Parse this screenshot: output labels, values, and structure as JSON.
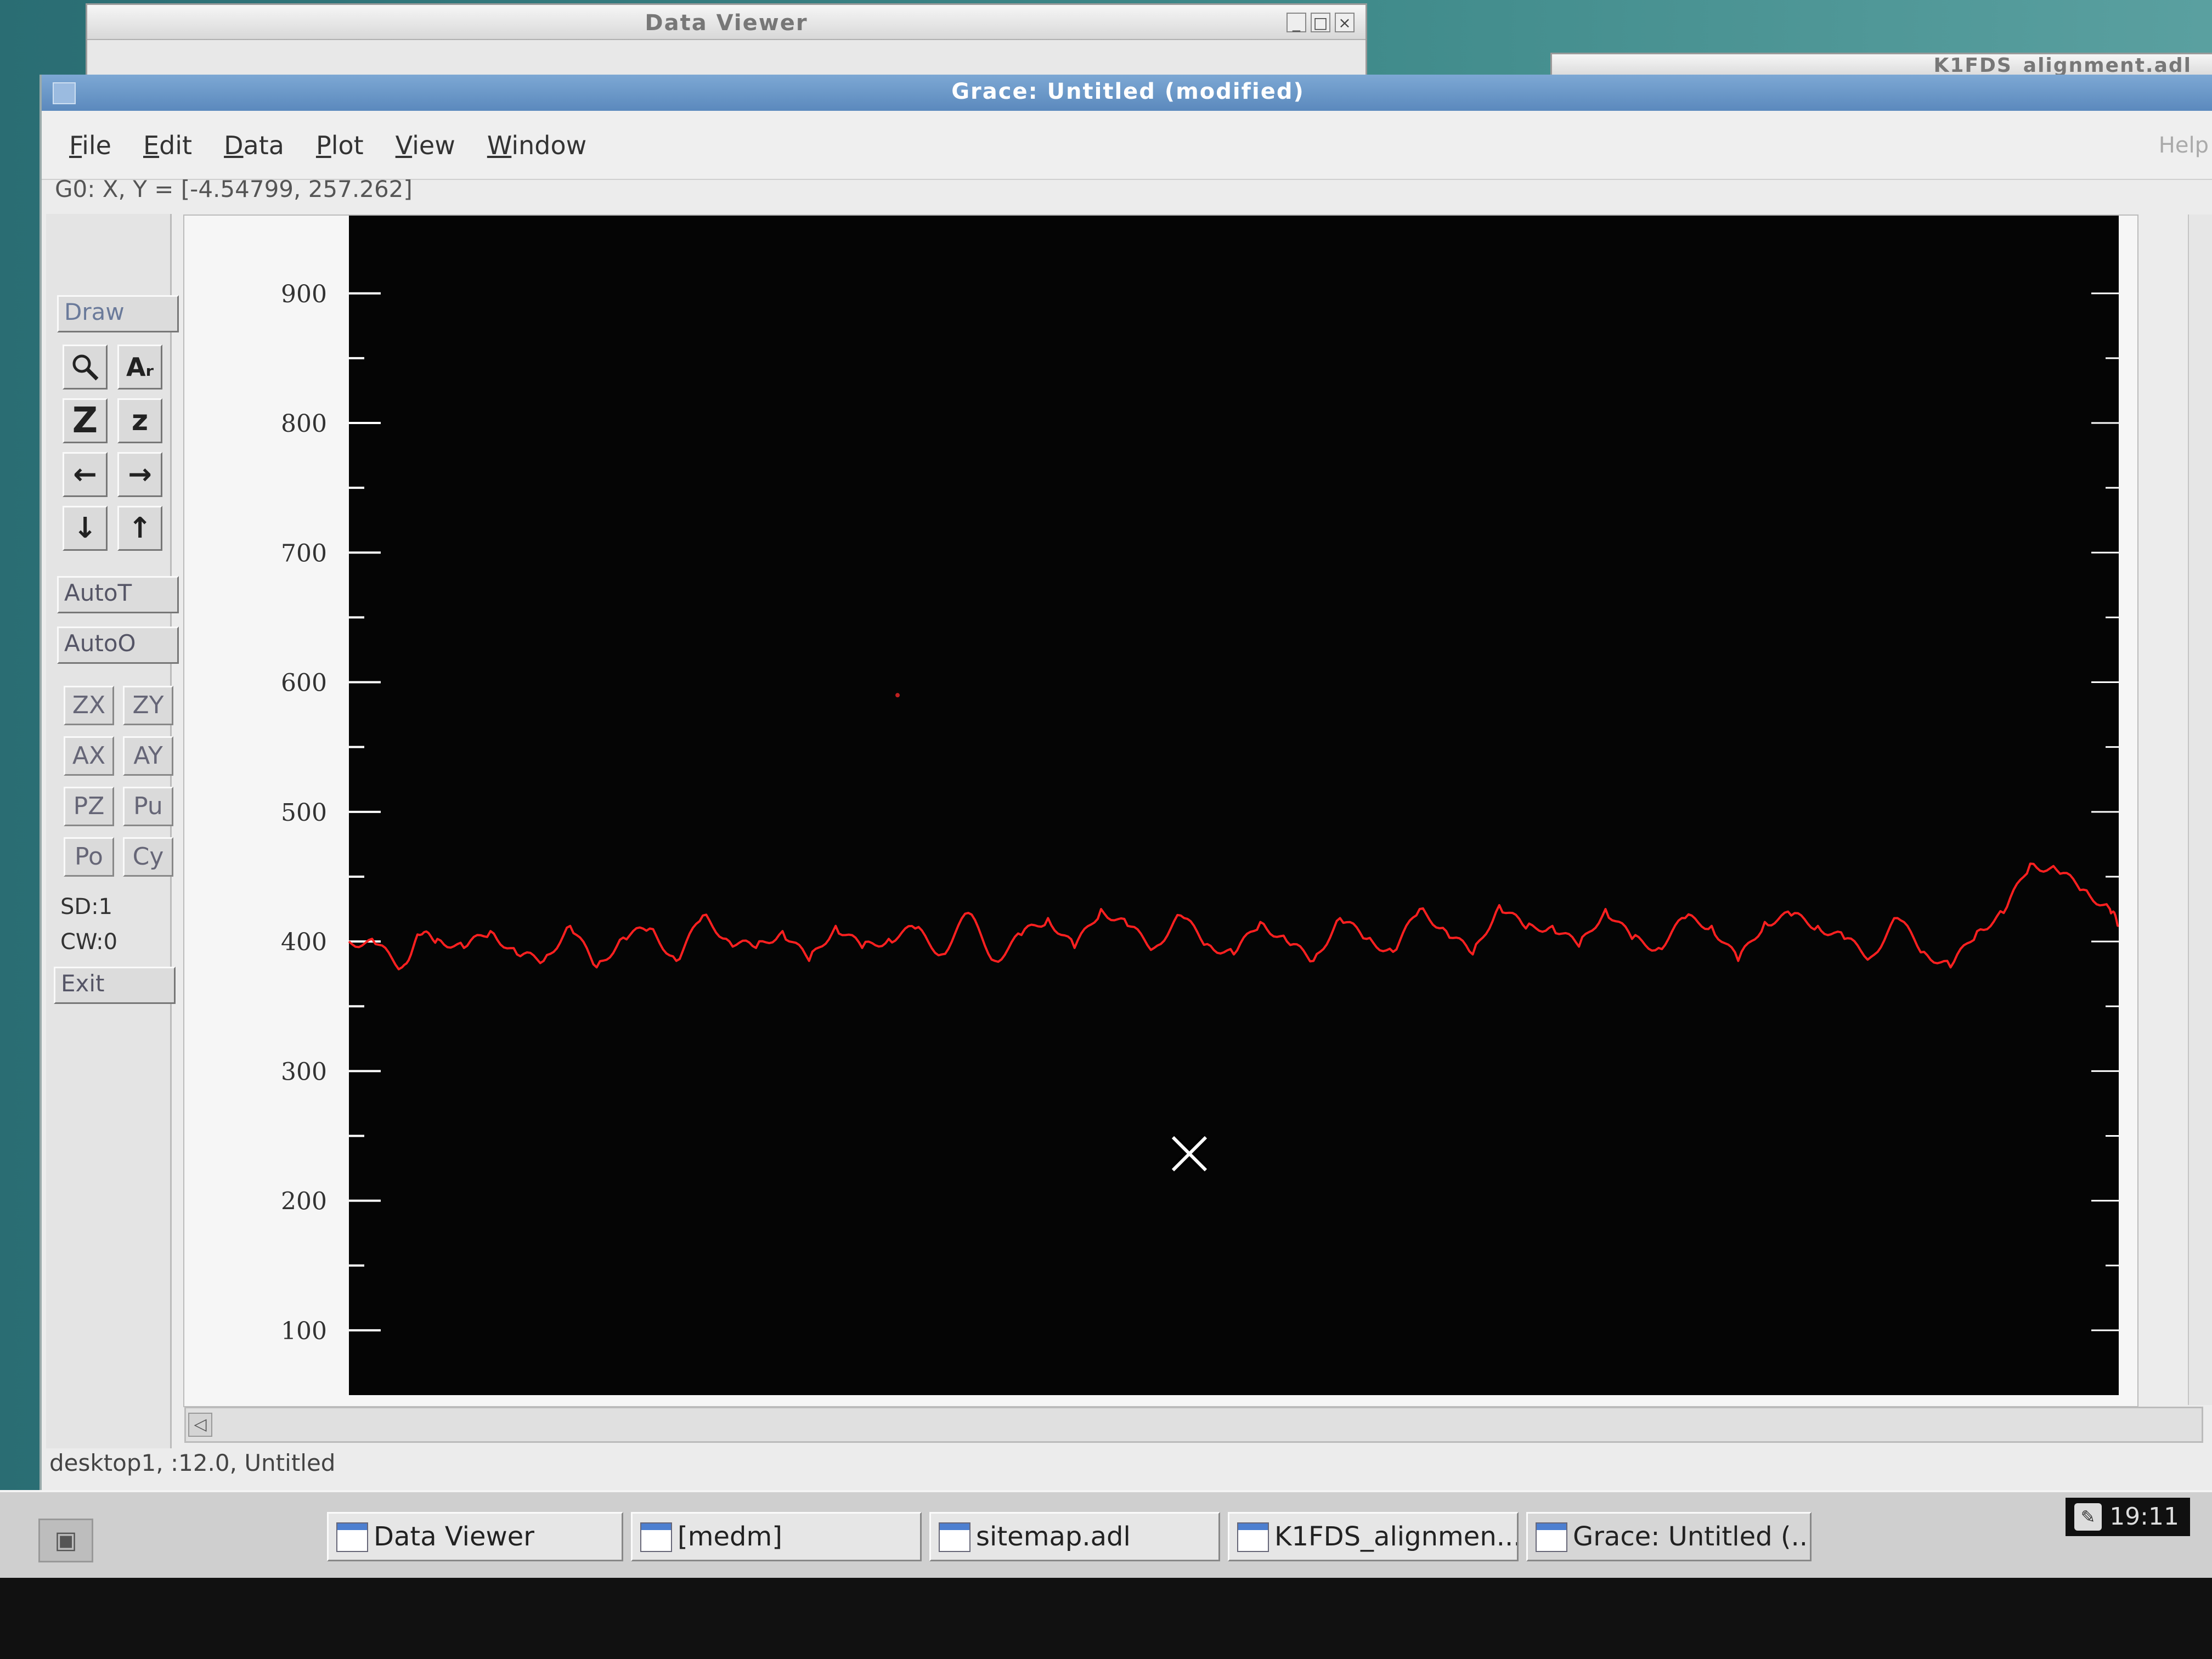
{
  "windows": {
    "data_viewer_title": "Data Viewer",
    "right_window_title": "K1FDS_alignment.adl",
    "main_title": "Grace: Untitled (modified)",
    "window_controls": [
      "_",
      "□",
      "×"
    ]
  },
  "menu": {
    "file": "File",
    "edit": "Edit",
    "data": "Data",
    "plot": "Plot",
    "view": "View",
    "window": "Window",
    "help": "Help"
  },
  "coords_readout": "G0: X, Y = [-4.54799, 257.262]",
  "toolbar": {
    "draw": "Draw",
    "zoom_icon": "🔍",
    "as_label": "Aᵣ",
    "z_large": "Z",
    "z_small": "z",
    "left_arrow": "←",
    "right_arrow": "→",
    "down_arrow": "↓",
    "up_arrow": "↑",
    "autot": "AutoT",
    "autoo": "AutoO",
    "zx": "ZX",
    "zy": "ZY",
    "ax": "AX",
    "ay": "AY",
    "pz": "PZ",
    "pu": "Pu",
    "po": "Po",
    "cy": "Cy",
    "sd": "SD:1",
    "cw": "CW:0",
    "exit": "Exit"
  },
  "chart_data": {
    "type": "line",
    "y_ticks": [
      "900",
      "800",
      "700",
      "600",
      "500",
      "400",
      "300",
      "200",
      "100"
    ],
    "ylim": [
      50,
      960
    ],
    "xlim": [
      0,
      100
    ],
    "grid": false,
    "series": [
      {
        "color": "#ff2020",
        "x": [
          0,
          1.5,
          3,
          4,
          5,
          6.5,
          8,
          9.5,
          11,
          12.5,
          14,
          15.5,
          17,
          18.5,
          20,
          21.5,
          23,
          24.5,
          26,
          27.5,
          29,
          30.5,
          32,
          33.5,
          35,
          36.5,
          38,
          39.5,
          41,
          42.5,
          44,
          45.5,
          47,
          48.5,
          50,
          51.5,
          53,
          54.5,
          56,
          57.5,
          59,
          60.5,
          62,
          63.5,
          65,
          66.5,
          68,
          69.5,
          71,
          72.5,
          74,
          75.5,
          77,
          78.5,
          80,
          81.5,
          83,
          84.5,
          86,
          87.5,
          89,
          90.5,
          92,
          93.5,
          95,
          96.5,
          98,
          99.5,
          100
        ],
        "y": [
          400,
          398,
          380,
          405,
          402,
          395,
          408,
          390,
          385,
          412,
          380,
          403,
          410,
          385,
          420,
          400,
          395,
          408,
          385,
          412,
          395,
          402,
          410,
          390,
          422,
          385,
          405,
          418,
          395,
          425,
          412,
          395,
          420,
          398,
          390,
          415,
          400,
          385,
          418,
          402,
          392,
          425,
          408,
          390,
          428,
          410,
          412,
          396,
          425,
          402,
          395,
          418,
          412,
          385,
          415,
          420,
          412,
          402,
          388,
          418,
          392,
          380,
          408,
          422,
          460,
          455,
          440,
          425,
          412
        ]
      }
    ],
    "annotations": [
      {
        "x": 31,
        "y": 590,
        "label": ""
      }
    ]
  },
  "canvas": {
    "cursor_icon": "crosshair-x"
  },
  "status": "desktop1, :12.0, Untitled",
  "taskbar": {
    "items": [
      "Data Viewer",
      "[medm]",
      "sitemap.adl",
      "K1FDS_alignmen...",
      "Grace: Untitled (..."
    ],
    "clock": "19:11"
  },
  "colors": {
    "plot_background": "#050505",
    "series": "#ff2020",
    "title_bar": "#5b89bd"
  }
}
